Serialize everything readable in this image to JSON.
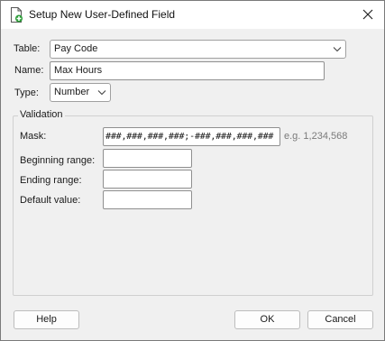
{
  "window": {
    "title": "Setup New User-Defined Field",
    "icon": "new-document-icon",
    "close_icon": "close-icon"
  },
  "form": {
    "table_label": "Table:",
    "table_value": "Pay Code",
    "name_label": "Name:",
    "name_value": "Max Hours",
    "type_label": "Type:",
    "type_value": "Number"
  },
  "validation": {
    "group_title": "Validation",
    "mask_label": "Mask:",
    "mask_value": "###,###,###,###;-###,###,###,###",
    "mask_example": "e.g. 1,234,568",
    "beginning_label": "Beginning range:",
    "beginning_value": "",
    "ending_label": "Ending range:",
    "ending_value": "",
    "default_label": "Default value:",
    "default_value": ""
  },
  "buttons": {
    "help": "Help",
    "ok": "OK",
    "cancel": "Cancel"
  }
}
